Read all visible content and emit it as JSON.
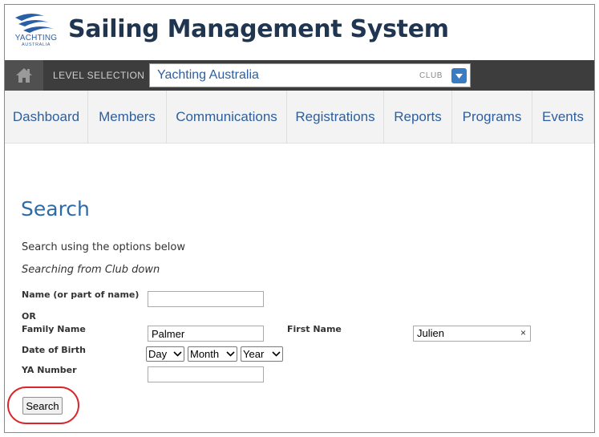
{
  "header": {
    "logo_text": "YACHTING",
    "logo_subtext": "AUSTRALIA",
    "app_title": "Sailing Management System"
  },
  "level_bar": {
    "label": "LEVEL SELECTION",
    "selected_value": "Yachting Australia",
    "level_tag": "CLUB"
  },
  "nav": {
    "items": [
      {
        "label": "Dashboard"
      },
      {
        "label": "Members"
      },
      {
        "label": "Communications"
      },
      {
        "label": "Registrations"
      },
      {
        "label": "Reports"
      },
      {
        "label": "Programs"
      },
      {
        "label": "Events"
      }
    ]
  },
  "content": {
    "title": "Search",
    "intro": "Search using the options below",
    "scope": "Searching from Club down"
  },
  "form": {
    "name_label": "Name (or part of name)",
    "name_value": "",
    "or_label": "OR",
    "family_name_label": "Family Name",
    "family_name_value": "Palmer",
    "first_name_label": "First Name",
    "first_name_value": "Julien",
    "clear_symbol": "×",
    "dob_label": "Date of Birth",
    "dob_day": "Day",
    "dob_month": "Month",
    "dob_year": "Year",
    "ya_number_label": "YA Number",
    "ya_number_value": "",
    "search_button": "Search"
  },
  "colors": {
    "title_navy": "#1f3550",
    "link_blue": "#2d5f9e",
    "bar_dark": "#3d3d3d",
    "highlight_red": "#d8262a"
  },
  "icons": {
    "logo": "yachting-australia-logo",
    "home": "home-icon",
    "dropdown": "chevron-down-icon"
  }
}
